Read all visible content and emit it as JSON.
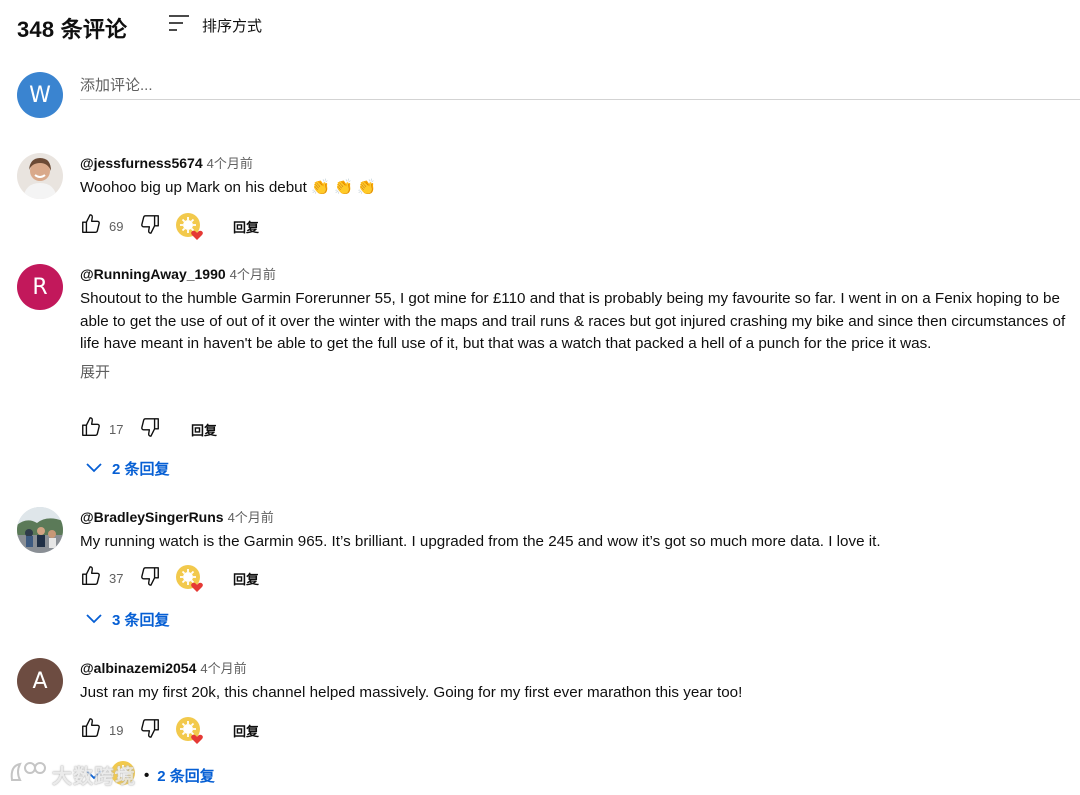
{
  "header": {
    "count_title": "348 条评论",
    "sort_label": "排序方式"
  },
  "add_comment": {
    "avatar_letter": "W",
    "avatar_color": "#3a84d0",
    "placeholder": "添加评论..."
  },
  "comments": [
    {
      "author": "@jessfurness5674",
      "time": "4个月前",
      "text": "Woohoo big up Mark on his debut 👏 👏 👏",
      "likes": "69",
      "reply_label": "回复",
      "creator_heart": true
    },
    {
      "author": "@RunningAway_1990",
      "time": "4个月前",
      "avatar_letter": "R",
      "avatar_color": "#c2185b",
      "text": "Shoutout to the humble Garmin Forerunner 55, I got mine for £110 and that is probably being my favourite so far. I went in on a Fenix hoping to be able to get the use of out of it over the winter with the maps and trail runs & races but got injured crashing my bike and since then circumstances of life have meant in haven't be able to get the full use of it, but that was a watch that packed a hell of a punch for the price it was.",
      "show_more": "展开",
      "likes": "17",
      "reply_label": "回复",
      "creator_heart": false,
      "replies_label": "2 条回复"
    },
    {
      "author": "@BradleySingerRuns",
      "time": "4个月前",
      "text": "My running watch is the Garmin 965. It’s brilliant. I upgraded from the 245 and wow it’s got so much more data. I love it.",
      "likes": "37",
      "reply_label": "回复",
      "creator_heart": true,
      "replies_label": "3 条回复"
    },
    {
      "author": "@albinazemi2054",
      "time": "4个月前",
      "avatar_letter": "A",
      "avatar_color": "#6d4c41",
      "text": "Just ran my first 20k, this channel helped massively. Going for my first ever marathon this year too!",
      "likes": "19",
      "reply_label": "回复",
      "creator_heart": true,
      "replies_label": "2 条回复",
      "replies_separator": "•"
    }
  ],
  "watermark": {
    "text": "大数跨境"
  },
  "colors": {
    "link_blue": "#065fd4",
    "secondary_text": "#606060",
    "heart_red": "#e53935",
    "badge_yellow": "#f2c94c"
  }
}
